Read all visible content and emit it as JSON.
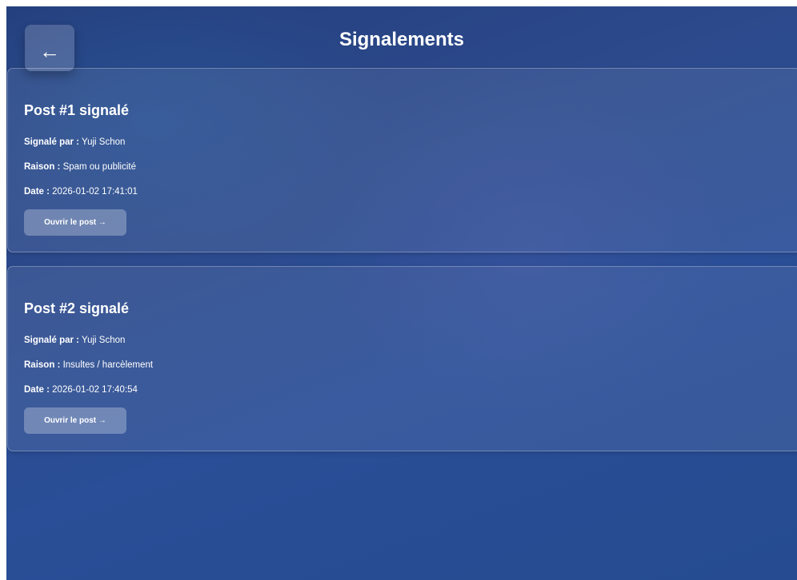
{
  "header": {
    "back_label": "←",
    "title": "Signalements"
  },
  "reports": [
    {
      "title": "Post #1 signalé",
      "reported_by_label": "Signalé par :",
      "reported_by": "Yuji Schon",
      "reason_label": "Raison :",
      "reason": "Spam ou publicité",
      "date_label": "Date :",
      "date": "2026-01-02 17:41:01",
      "open_label": "Ouvrir le post →"
    },
    {
      "title": "Post #2 signalé",
      "reported_by_label": "Signalé par :",
      "reported_by": "Yuji Schon",
      "reason_label": "Raison :",
      "reason": "Insultes / harcèlement",
      "date_label": "Date :",
      "date": "2026-01-02 17:40:54",
      "open_label": "Ouvrir le post →"
    }
  ]
}
